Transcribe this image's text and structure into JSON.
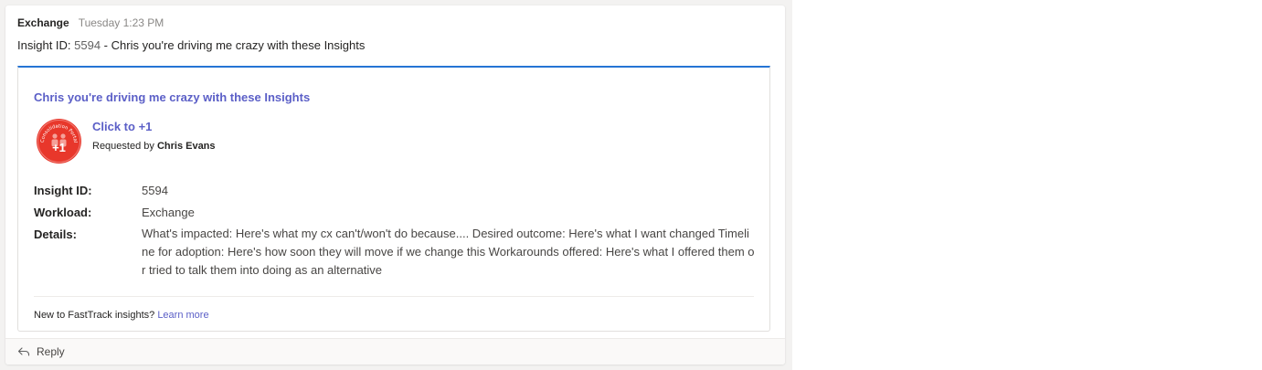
{
  "message": {
    "sender": "Exchange",
    "timestamp": "Tuesday 1:23 PM",
    "body_prefix": "Insight ID: ",
    "body_id": "5594",
    "body_suffix": " - Chris you're driving me crazy with these Insights"
  },
  "card": {
    "accent_color": "#2574d4",
    "title": "Chris you're driving me crazy with these Insights",
    "badge": {
      "icon": "consolidation-portal-badge-icon",
      "ring_text": "Consolidation Portal",
      "count": "+1",
      "color": "#e8372b"
    },
    "action": {
      "label": "Click to +1"
    },
    "requested_prefix": "Requested by ",
    "requested_by": "Chris Evans",
    "facts": [
      {
        "label": "Insight ID:",
        "value": "5594"
      },
      {
        "label": "Workload:",
        "value": "Exchange"
      },
      {
        "label": "Details:",
        "value": "What's impacted: Here's what my cx can't/won't do because.... Desired outcome: Here's what I want changed Timeline for adoption: Here's how soon they will move if we change this Workarounds offered: Here's what I offered them or tried to talk them into doing as an alternative"
      }
    ],
    "footer_text": "New to FastTrack insights? ",
    "footer_link": "Learn more"
  },
  "reply": {
    "icon": "reply-arrow-icon",
    "label": "Reply"
  }
}
